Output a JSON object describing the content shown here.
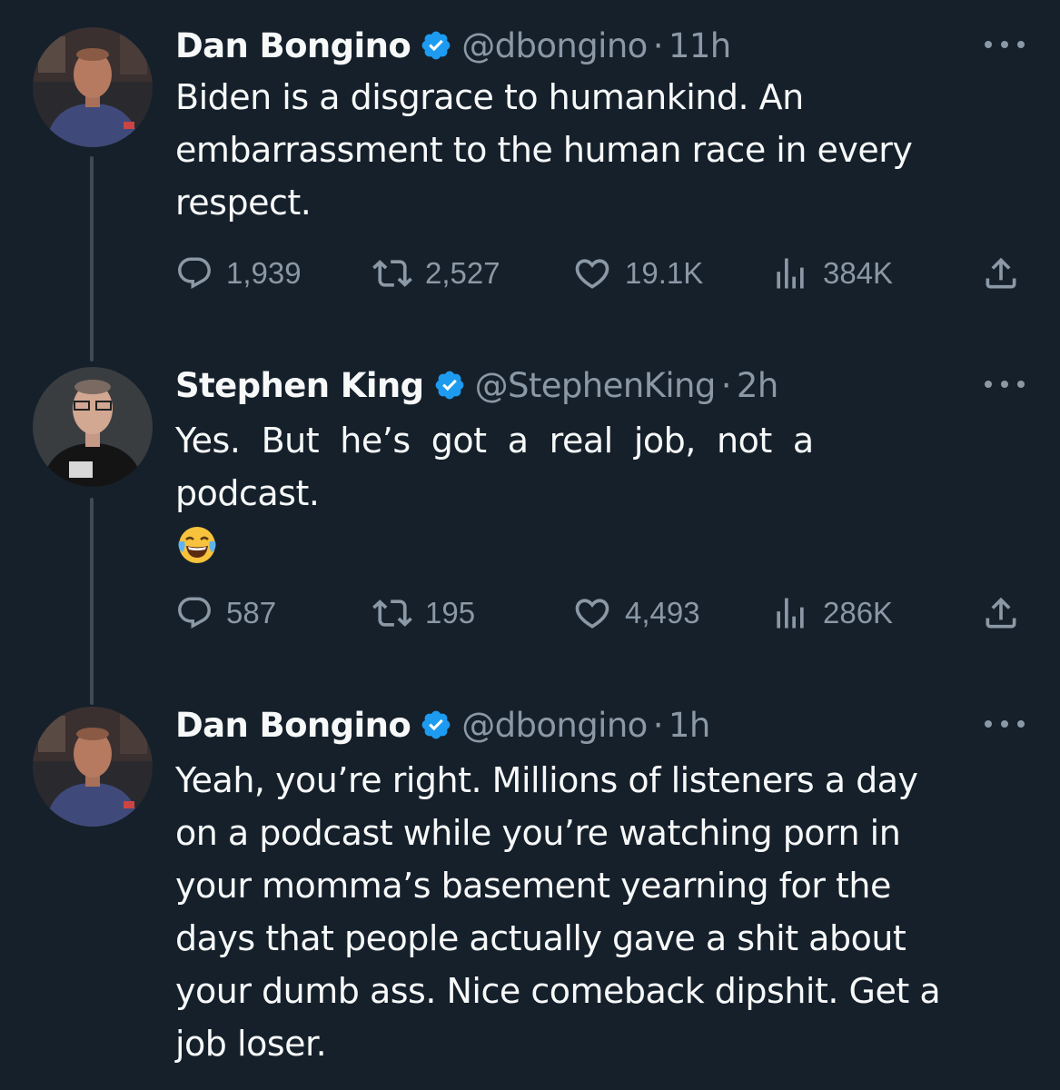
{
  "tweets": [
    {
      "name": "Dan Bongino",
      "handle": "@dbongino",
      "separator": "·",
      "time": "11h",
      "text_lines": [
        "Biden is a disgrace to humankind. An",
        "embarrassment to the human race in every",
        "respect."
      ],
      "replies": "1,939",
      "retweets": "2,527",
      "likes": "19.1K",
      "views": "384K"
    },
    {
      "name": "Stephen King",
      "handle": "@StephenKing",
      "separator": "·",
      "time": "2h",
      "text_lines": [
        "Yes.  But  he’s  got  a  real  job,  not  a",
        "podcast."
      ],
      "emoji": "face-with-tears-of-joy",
      "replies": "587",
      "retweets": "195",
      "likes": "4,493",
      "views": "286K"
    },
    {
      "name": "Dan Bongino",
      "handle": "@dbongino",
      "separator": "·",
      "time": "1h",
      "text_lines": [
        "Yeah, you’re right. Millions of listeners a day",
        "on a podcast while you’re watching porn in",
        "your momma’s basement yearning for the",
        "days that people actually gave a shit about",
        "your dumb ass. Nice comeback dipshit. Get a",
        "job loser."
      ]
    }
  ],
  "colors": {
    "background": "#15202b",
    "text": "#f7f9f9",
    "muted": "#8b98a5",
    "verified": "#1d9bf0",
    "thread_line": "#3e4a56"
  }
}
